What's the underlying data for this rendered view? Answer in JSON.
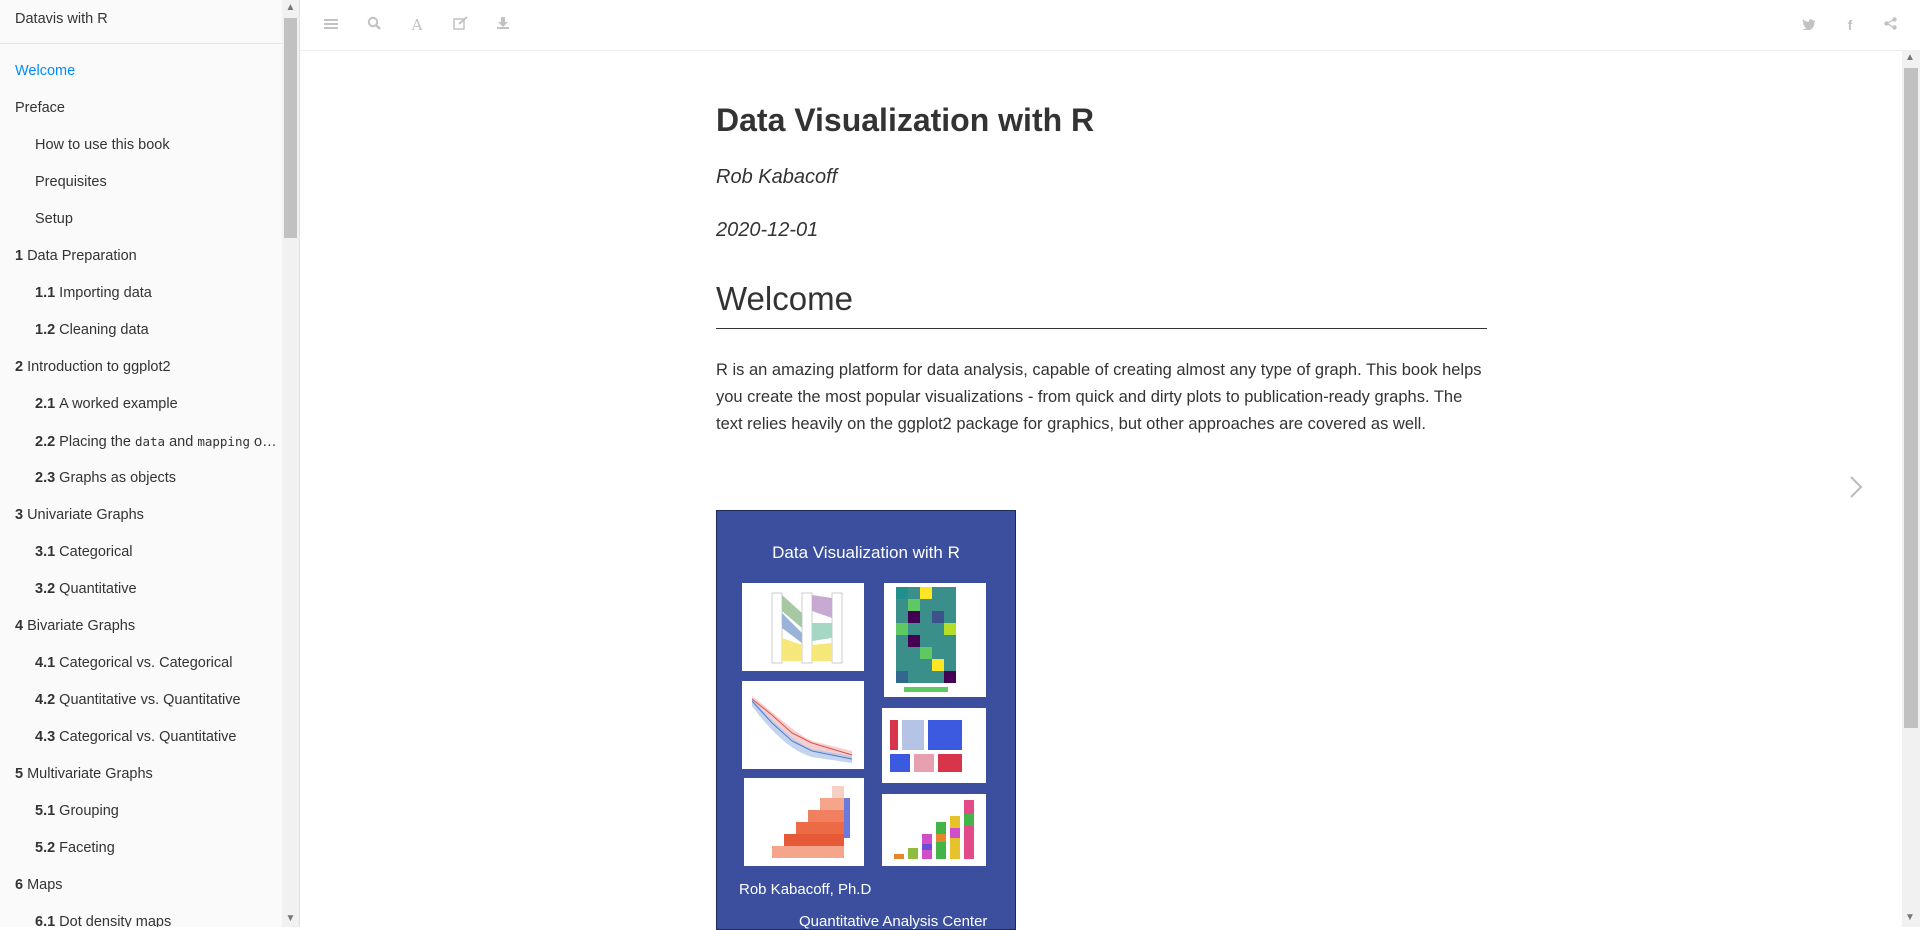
{
  "sidebar": {
    "brand": "Datavis with R",
    "items": [
      {
        "num": "",
        "label": "Welcome",
        "level": 0,
        "active": true
      },
      {
        "num": "",
        "label": "Preface",
        "level": 0
      },
      {
        "num": "",
        "label": "How to use this book",
        "level": 1
      },
      {
        "num": "",
        "label": "Prequisites",
        "level": 1
      },
      {
        "num": "",
        "label": "Setup",
        "level": 1
      },
      {
        "num": "1",
        "label": "Data Preparation",
        "level": 0
      },
      {
        "num": "1.1",
        "label": "Importing data",
        "level": 1
      },
      {
        "num": "1.2",
        "label": "Cleaning data",
        "level": 1
      },
      {
        "num": "2",
        "label": "Introduction to ggplot2",
        "level": 0
      },
      {
        "num": "2.1",
        "label": "A worked example",
        "level": 1
      },
      {
        "num": "2.2",
        "label": "Placing the data and mapping options",
        "level": 1,
        "code": true
      },
      {
        "num": "2.3",
        "label": "Graphs as objects",
        "level": 1
      },
      {
        "num": "3",
        "label": "Univariate Graphs",
        "level": 0
      },
      {
        "num": "3.1",
        "label": "Categorical",
        "level": 1
      },
      {
        "num": "3.2",
        "label": "Quantitative",
        "level": 1
      },
      {
        "num": "4",
        "label": "Bivariate Graphs",
        "level": 0
      },
      {
        "num": "4.1",
        "label": "Categorical vs. Categorical",
        "level": 1
      },
      {
        "num": "4.2",
        "label": "Quantitative vs. Quantitative",
        "level": 1
      },
      {
        "num": "4.3",
        "label": "Categorical vs. Quantitative",
        "level": 1
      },
      {
        "num": "5",
        "label": "Multivariate Graphs",
        "level": 0
      },
      {
        "num": "5.1",
        "label": "Grouping",
        "level": 1
      },
      {
        "num": "5.2",
        "label": "Faceting",
        "level": 1
      },
      {
        "num": "6",
        "label": "Maps",
        "level": 0
      },
      {
        "num": "6.1",
        "label": "Dot density maps",
        "level": 1
      }
    ]
  },
  "toolbar": {
    "left_icons": [
      "menu-icon",
      "search-icon",
      "font-icon",
      "edit-icon",
      "download-icon"
    ],
    "right_icons": [
      "twitter-icon",
      "facebook-icon",
      "share-icon"
    ]
  },
  "content": {
    "title": "Data Visualization with R",
    "author": "Rob Kabacoff",
    "date": "2020-12-01",
    "section_heading": "Welcome",
    "paragraph": "R is an amazing platform for data analysis, capable of creating almost any type of graph. This book helps you create the most popular visualizations - from quick and dirty plots to publication-ready graphs. The text relies heavily on the ggplot2 package for graphics, but other approaches are covered as well."
  },
  "cover": {
    "title": "Data Visualization with R",
    "author": "Rob Kabacoff, Ph.D",
    "institution": "Quantitative Analysis Center",
    "background": "#3b4f9e"
  },
  "colors": {
    "accent": "#008cff",
    "text": "#333333"
  }
}
